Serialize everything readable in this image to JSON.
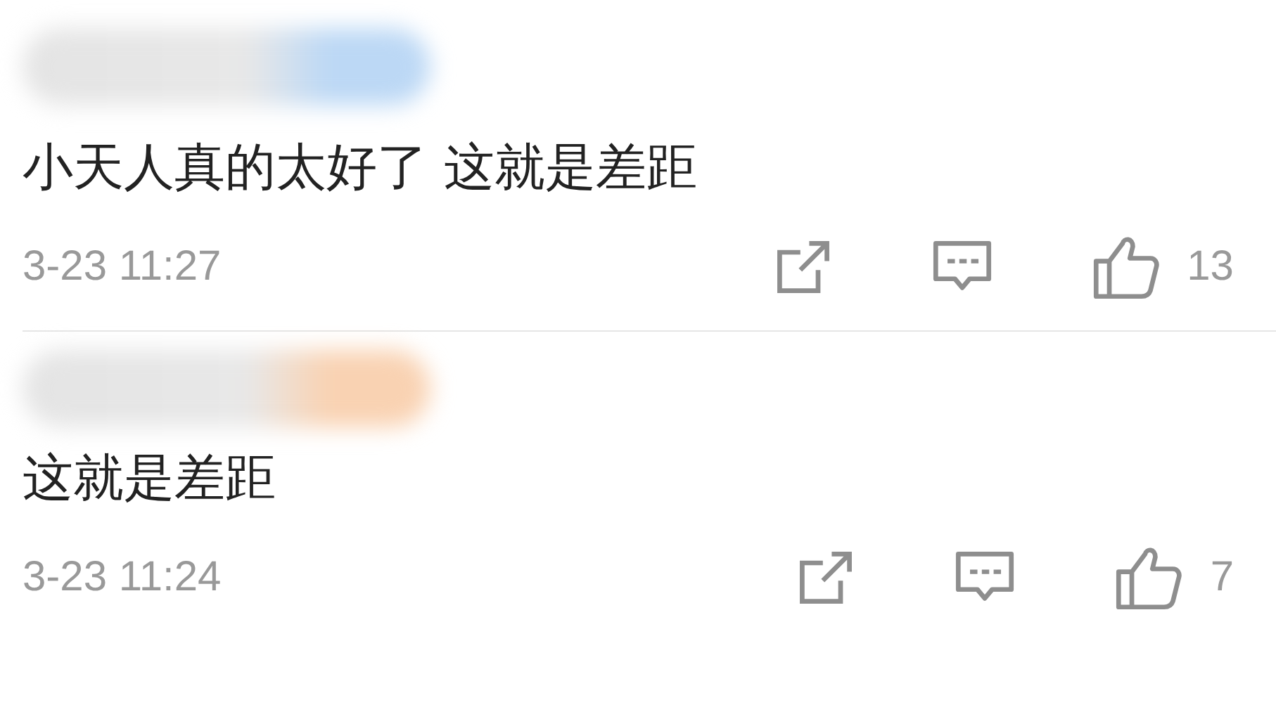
{
  "comments": [
    {
      "color": "#bcd8f5",
      "text": "小天人真的太好了 这就是差距",
      "time": "3-23 11:27",
      "likes": "13"
    },
    {
      "color": "#f9d2b2",
      "text": "这就是差距",
      "time": "3-23 11:24",
      "likes": "7"
    }
  ]
}
